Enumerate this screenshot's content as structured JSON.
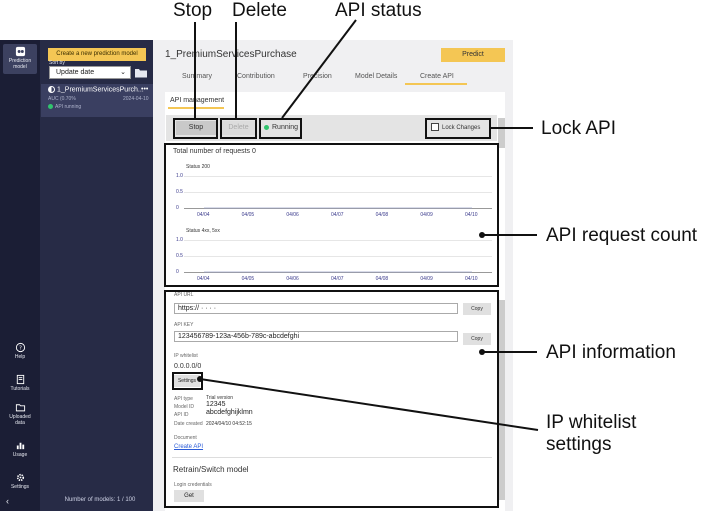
{
  "sidebar": {
    "prediction_model_label_line1": "Prediction",
    "prediction_model_label_line2": "model",
    "help_label": "Help",
    "tutorials_label": "Tutorials",
    "uploaded_data_line1": "Uploaded",
    "uploaded_data_line2": "data",
    "usage_label": "Usage",
    "settings_label": "Settings",
    "collapse_glyph": "‹"
  },
  "model_list": {
    "create_button": "Create a new prediction model",
    "sort_by_label": "Sort by",
    "sort_value": "Update date",
    "item": {
      "title": "1_PremiumServicesPurch...",
      "more": "•••",
      "auc": "AUC (0.70%",
      "date": "2024-04-10",
      "status": "API running"
    },
    "count": "Number of models: 1 / 100"
  },
  "main": {
    "title": "1_PremiumServicesPurchase",
    "predict_button": "Predict",
    "tabs": [
      "Summary",
      "Contribution",
      "Precision",
      "Model Details",
      "Create API"
    ],
    "active_tab": "Create API",
    "section_tab": "API management",
    "stop_button": "Stop",
    "delete_button": "Delete",
    "status": "Running",
    "lock_changes": "Lock Changes"
  },
  "requests": {
    "total": "Total number of requests 0",
    "chart1_label": "Status 200",
    "chart2_label": "Status 4xx, 5xx"
  },
  "chart_data": [
    {
      "type": "line",
      "title": "Status 200",
      "categories": [
        "04/04",
        "04/05",
        "04/06",
        "04/07",
        "04/08",
        "04/09",
        "04/10"
      ],
      "values": [
        0,
        0,
        0,
        0,
        0,
        0,
        0
      ],
      "yticks": [
        "1.0",
        "0.5",
        "0"
      ],
      "ylim": [
        0,
        1
      ]
    },
    {
      "type": "line",
      "title": "Status 4xx, 5xx",
      "categories": [
        "04/04",
        "04/05",
        "04/06",
        "04/07",
        "04/08",
        "04/09",
        "04/10"
      ],
      "values": [
        0,
        0,
        0,
        0,
        0,
        0,
        0
      ],
      "yticks": [
        "1.0",
        "0.5",
        "0"
      ],
      "ylim": [
        0,
        1
      ]
    }
  ],
  "api_info": {
    "url_label": "API URL",
    "url_value": "https:// · · · ·",
    "key_label": "API KEY",
    "key_value": "123456789-123a-456b-789c-abcdefghi",
    "copy": "Copy",
    "whitelist_label": "IP whitelist",
    "whitelist_value": "0.0.0.0/0",
    "settings_button": "Settings",
    "api_type_label": "API type",
    "api_type_value": "Trial version",
    "model_id_label": "Model ID",
    "model_id_value": "12345",
    "api_id_label": "API ID",
    "api_id_value": "abcdefghijklmn",
    "date_created_label": "Date created",
    "date_created_value": "2024/04/10 04:52:15",
    "document_label": "Document",
    "create_api_link": "Create API",
    "retrain_heading": "Retrain/Switch model",
    "login_credentials_label": "Login credentials",
    "get_button": "Get"
  },
  "callouts": {
    "stop": "Stop",
    "delete": "Delete",
    "api_status": "API status",
    "lock_api": "Lock API",
    "api_request_count": "API request count",
    "api_information": "API information",
    "ip_whitelist_line1": "IP whitelist",
    "ip_whitelist_line2": "settings"
  }
}
